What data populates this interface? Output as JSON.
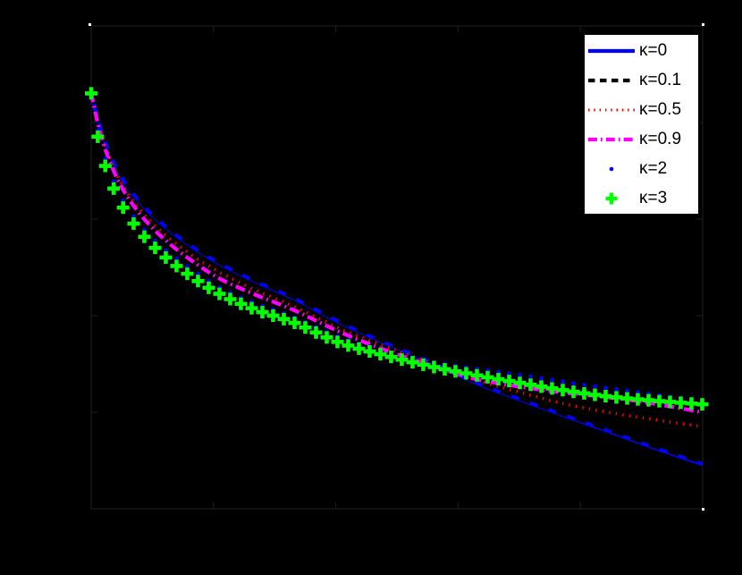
{
  "window": {
    "background": "#000000"
  },
  "axes": {
    "frame_color": "#1a1a1a",
    "x_ticks": [
      0,
      1,
      2,
      3,
      4,
      5
    ],
    "y_ticks": [
      0,
      0.232,
      0.464,
      0.696,
      0.928,
      1.16
    ],
    "tick_labels_visible": false
  },
  "chart_data": {
    "type": "line",
    "title": "",
    "xlabel": "",
    "ylabel": "",
    "xlim": [
      0,
      5
    ],
    "ylim": [
      0,
      1.16
    ],
    "grid": false,
    "legend_position": "top-right",
    "x": [
      0,
      0.058,
      0.132,
      0.241,
      0.387,
      0.57,
      0.789,
      1.045,
      1.338,
      1.667,
      2.032,
      2.398,
      2.763,
      3.129,
      3.494,
      3.86,
      4.225,
      4.591,
      5.0
    ],
    "series": [
      {
        "name": "κ=0",
        "color": "#0000ff",
        "line_style": "solid",
        "marker": "none",
        "y": [
          1.0,
          0.931,
          0.867,
          0.8,
          0.74,
          0.687,
          0.637,
          0.59,
          0.547,
          0.504,
          0.448,
          0.399,
          0.354,
          0.305,
          0.264,
          0.225,
          0.187,
          0.148,
          0.107
        ]
      },
      {
        "name": "κ=0.1",
        "color": "#000000",
        "line_style": "dashed",
        "marker": "none",
        "y": [
          1.0,
          0.933,
          0.869,
          0.802,
          0.742,
          0.689,
          0.639,
          0.592,
          0.549,
          0.506,
          0.45,
          0.401,
          0.356,
          0.307,
          0.266,
          0.227,
          0.19,
          0.151,
          0.111
        ]
      },
      {
        "name": "κ=0.5",
        "color": "#ff0000",
        "line_style": "dotted",
        "marker": "none",
        "y": [
          1.0,
          0.925,
          0.856,
          0.785,
          0.723,
          0.667,
          0.616,
          0.569,
          0.526,
          0.485,
          0.433,
          0.391,
          0.352,
          0.311,
          0.281,
          0.253,
          0.232,
          0.215,
          0.197
        ]
      },
      {
        "name": "κ=0.9",
        "color": "#ff00ff",
        "line_style": "dashdot",
        "marker": "none",
        "y": [
          1.0,
          0.921,
          0.85,
          0.777,
          0.712,
          0.655,
          0.603,
          0.554,
          0.515,
          0.476,
          0.425,
          0.382,
          0.346,
          0.313,
          0.294,
          0.279,
          0.268,
          0.253,
          0.232
        ]
      },
      {
        "name": "κ=2",
        "color": "#0000ff",
        "line_style": "none",
        "marker": "dot",
        "y": [
          1.0,
          0.903,
          0.826,
          0.751,
          0.687,
          0.631,
          0.582,
          0.532,
          0.494,
          0.459,
          0.412,
          0.38,
          0.354,
          0.337,
          0.322,
          0.305,
          0.29,
          0.275,
          0.258
        ]
      },
      {
        "name": "κ=3",
        "color": "#00ff00",
        "line_style": "none",
        "marker": "plus",
        "y": [
          0.998,
          0.888,
          0.809,
          0.734,
          0.67,
          0.614,
          0.564,
          0.517,
          0.479,
          0.446,
          0.399,
          0.369,
          0.343,
          0.322,
          0.303,
          0.285,
          0.27,
          0.26,
          0.251
        ]
      }
    ]
  },
  "legend": {
    "background": "#ffffff",
    "border_color": "#000000",
    "entries": [
      {
        "label": "κ=0"
      },
      {
        "label": "κ=0.1"
      },
      {
        "label": "κ=0.5"
      },
      {
        "label": "κ=0.9"
      },
      {
        "label": "κ=2"
      },
      {
        "label": "κ=3"
      }
    ]
  }
}
